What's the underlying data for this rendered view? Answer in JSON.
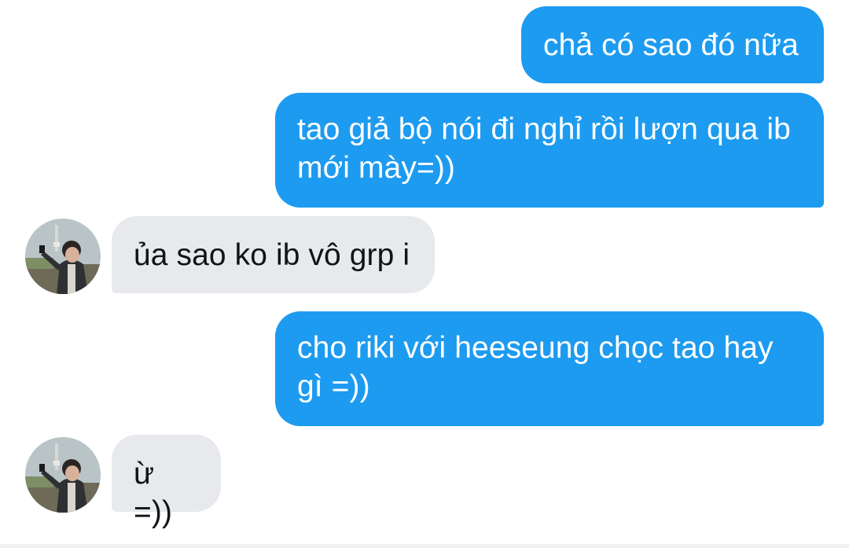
{
  "messages": [
    {
      "direction": "outgoing",
      "text": "chả có sao đó nữa"
    },
    {
      "direction": "outgoing",
      "text": "tao giả bộ nói đi nghỉ rồi lượn qua ib mới mày=))"
    },
    {
      "direction": "incoming",
      "text": "ủa sao ko ib vô grp i",
      "avatar": "user-photo"
    },
    {
      "direction": "outgoing",
      "text": "cho riki với heeseung chọc tao hay gì =))"
    },
    {
      "direction": "incoming",
      "text": "ừ =))",
      "avatar": "user-photo"
    }
  ],
  "colors": {
    "outgoing_bubble": "#1d9bf0",
    "incoming_bubble": "#e7e9ec",
    "outgoing_text": "#ffffff",
    "incoming_text": "#0f1419"
  }
}
